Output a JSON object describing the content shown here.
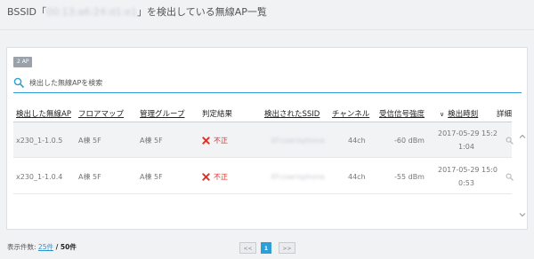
{
  "title": {
    "prefix": "BSSID「",
    "bssid": "00:13:a6:24:d1:e1",
    "suffix": "」を検出している無線AP一覧"
  },
  "badge": "2 AP",
  "search": {
    "placeholder": "検出した無線APを検索",
    "value": ""
  },
  "columns": {
    "detected_ap": "検出した無線AP",
    "floor_map": "フロアマップ",
    "group": "管理グループ",
    "result": "判定結果",
    "ssid": "検出されたSSID",
    "channel": "チャンネル",
    "signal": "受信信号強度",
    "sort_indicator": "∨",
    "detect_time": "検出時刻",
    "detail": "詳細"
  },
  "rows": [
    {
      "ap": "x230_1-1.0.5",
      "floor": "A棟 5F",
      "group": "A棟 5F",
      "result": "不正",
      "ssid": "XFcowrisphone",
      "channel": "44ch",
      "signal": "-60 dBm",
      "time_line1": "2017-05-29 15:2",
      "time_line2": "1:04"
    },
    {
      "ap": "x230_1-1.0.4",
      "floor": "A棟 5F",
      "group": "A棟 5F",
      "result": "不正",
      "ssid": "XFcowrisphone",
      "channel": "44ch",
      "signal": "-55 dBm",
      "time_line1": "2017-05-29 15:0",
      "time_line2": "0:53"
    }
  ],
  "footer": {
    "label": "表示件数: ",
    "per_page": "25件",
    "total": " / 50件"
  },
  "pager": {
    "prev": "<<",
    "page": "1",
    "next": ">>"
  },
  "colors": {
    "accent": "#2c9fd6",
    "danger": "#d9332b",
    "badge": "#9aa1a9"
  },
  "icons": [
    "search-icon",
    "x-icon",
    "magnifier-icon",
    "chevron-up-icon",
    "chevron-down-icon"
  ]
}
